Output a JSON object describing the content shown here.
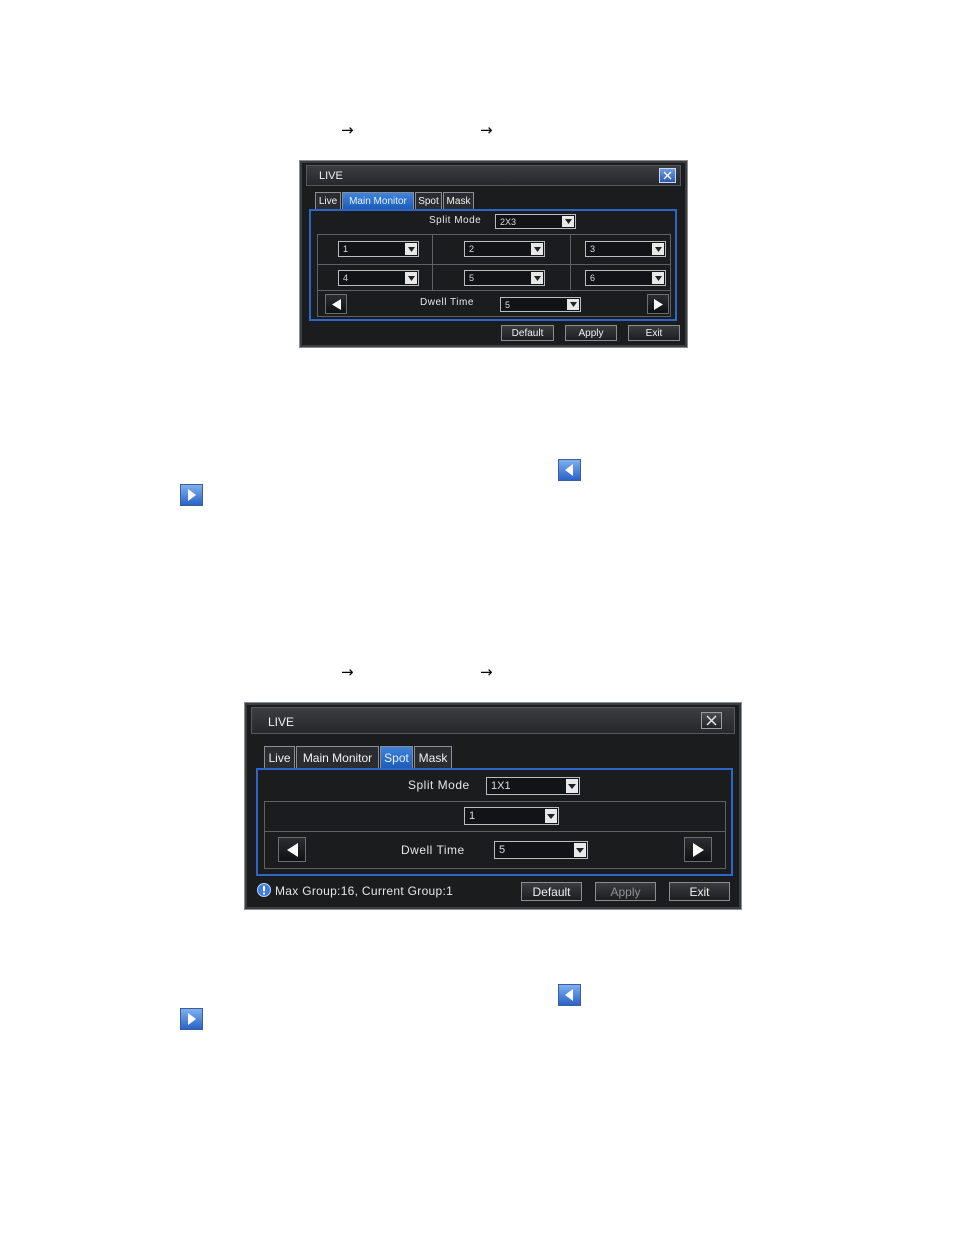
{
  "dialog1": {
    "title": "LIVE",
    "tabs": [
      "Live",
      "Main Monitor",
      "Spot",
      "Mask"
    ],
    "active_tab": "Main Monitor",
    "split_mode_label": "Split Mode",
    "split_mode_value": "2X3",
    "channels": [
      "1",
      "2",
      "3",
      "4",
      "5",
      "6"
    ],
    "dwell_time_label": "Dwell Time",
    "dwell_time_value": "5",
    "buttons": {
      "default": "Default",
      "apply": "Apply",
      "exit": "Exit"
    }
  },
  "dialog2": {
    "title": "LIVE",
    "tabs": [
      "Live",
      "Main Monitor",
      "Spot",
      "Mask"
    ],
    "active_tab": "Spot",
    "split_mode_label": "Split Mode",
    "split_mode_value": "1X1",
    "channel": "1",
    "dwell_time_label": "Dwell Time",
    "dwell_time_value": "5",
    "info": "Max Group:16, Current Group:1",
    "buttons": {
      "default": "Default",
      "apply": "Apply",
      "exit": "Exit"
    }
  },
  "colors": {
    "accent": "#2f65c8",
    "tab_active": "#1d5cb8",
    "dialog_bg": "#1b1c1e",
    "inline_button": "#2e6ed8"
  }
}
